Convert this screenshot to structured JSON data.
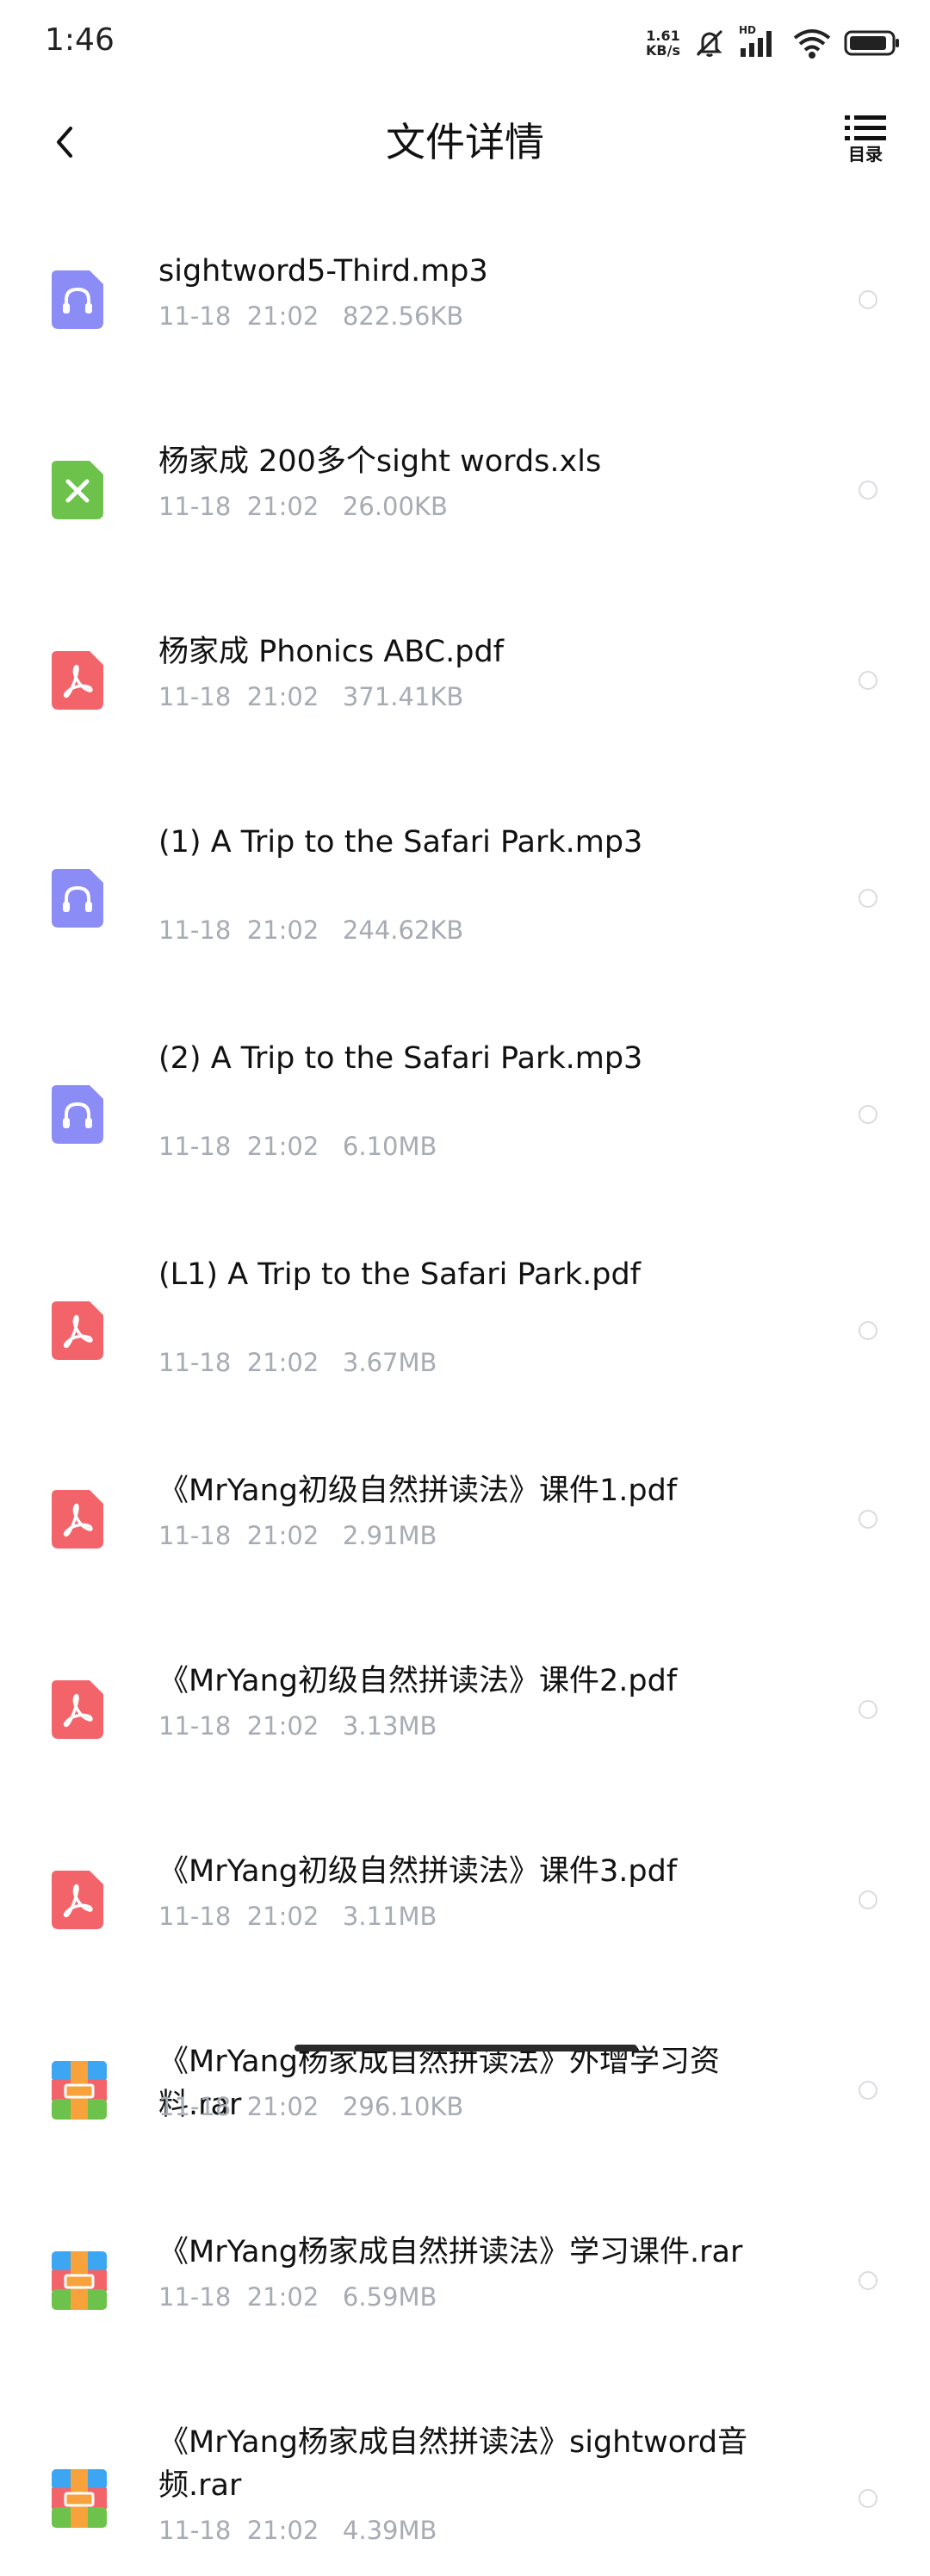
{
  "status_bar": {
    "time": "1:46",
    "net_speed_value": "1.61",
    "net_speed_unit": "KB/s",
    "signal_label": "HD"
  },
  "header": {
    "title": "文件详情",
    "toc_label": "目录"
  },
  "files": [
    {
      "name": "sightword5-Third.mp3",
      "meta": "11-18  21:02   822.56KB",
      "type": "audio"
    },
    {
      "name": "杨家成 200多个sight words.xls",
      "meta": "11-18  21:02   26.00KB",
      "type": "excel"
    },
    {
      "name": "杨家成 Phonics ABC.pdf",
      "meta": "11-18  21:02   371.41KB",
      "type": "pdf"
    },
    {
      "name": "(1) A Trip to the Safari Park.mp3",
      "meta": "11-18  21:02   244.62KB",
      "type": "audio"
    },
    {
      "name": "(2) A Trip to the Safari Park.mp3",
      "meta": "11-18  21:02   6.10MB",
      "type": "audio"
    },
    {
      "name": "(L1) A Trip to the Safari Park.pdf",
      "meta": "11-18  21:02   3.67MB",
      "type": "pdf"
    },
    {
      "name": "《MrYang初级自然拼读法》课件1.pdf",
      "meta": "11-18  21:02   2.91MB",
      "type": "pdf"
    },
    {
      "name": "《MrYang初级自然拼读法》课件2.pdf",
      "meta": "11-18  21:02   3.13MB",
      "type": "pdf"
    },
    {
      "name": "《MrYang初级自然拼读法》课件3.pdf",
      "meta": "11-18  21:02   3.11MB",
      "type": "pdf"
    },
    {
      "name": "《MrYang杨家成自然拼读法》外增学习资料.rar",
      "meta": "11-18  21:02   296.10KB",
      "type": "archive"
    },
    {
      "name": "《MrYang杨家成自然拼读法》学习课件.rar",
      "meta": "11-18  21:02   6.59MB",
      "type": "archive"
    },
    {
      "name": "《MrYang杨家成自然拼读法》sightword音频.rar",
      "meta": "11-18  21:02   4.39MB",
      "type": "archive"
    }
  ],
  "colors": {
    "audio": "#8c8cf6",
    "excel": "#6cc24a",
    "pdf": "#f2646a",
    "meta_text": "#a7abb3"
  }
}
